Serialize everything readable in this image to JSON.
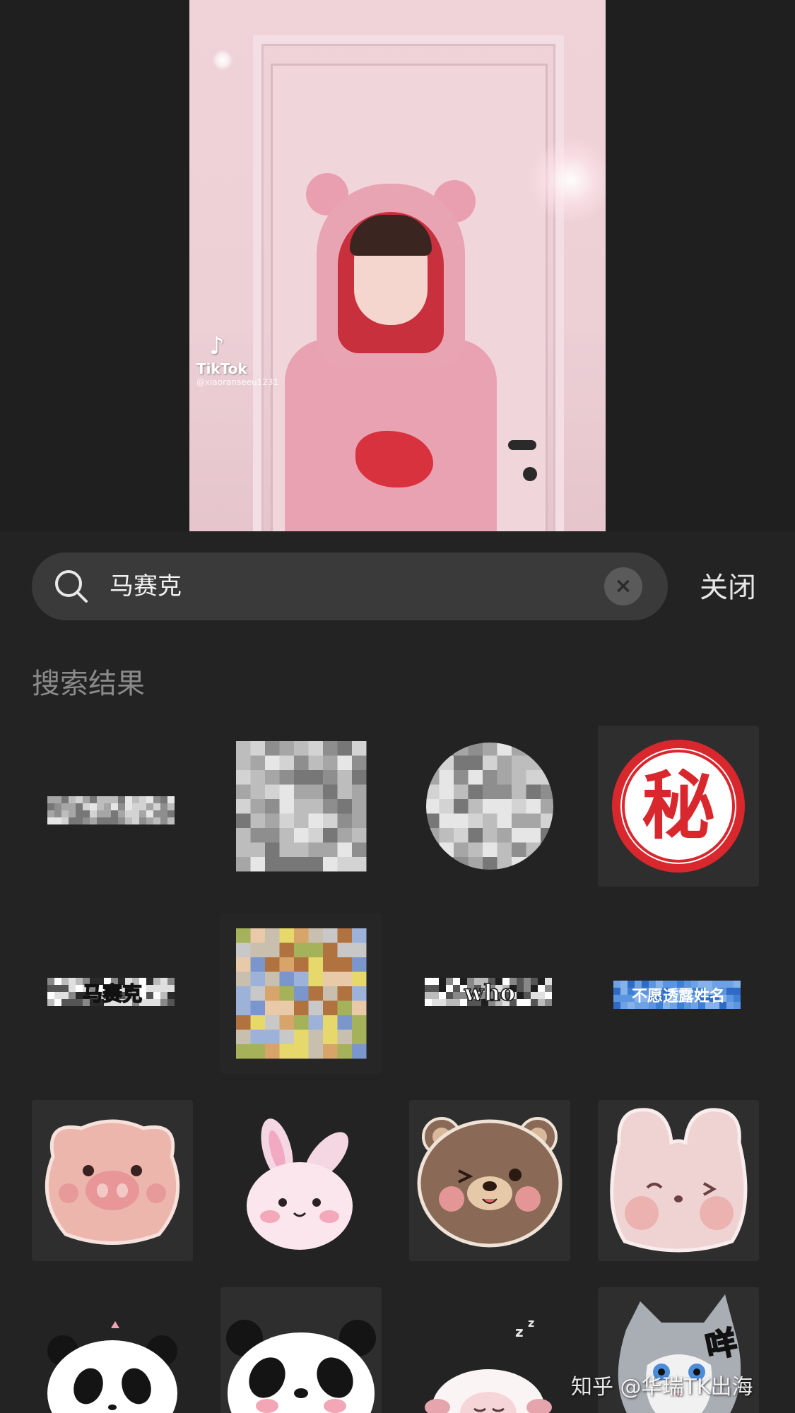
{
  "video": {
    "brand": "TikTok",
    "handle": "@xiaoranseeu1231"
  },
  "search": {
    "query": "马赛克",
    "clear_icon": "close-icon"
  },
  "close_label": "关闭",
  "results_title": "搜索结果",
  "stickers": [
    {
      "name": "mosaic-strip-sticker"
    },
    {
      "name": "mosaic-square-sticker"
    },
    {
      "name": "mosaic-circle-sticker"
    },
    {
      "name": "secret-stamp-sticker",
      "label": "秘"
    },
    {
      "name": "mosaic-label-sticker",
      "label": "马赛克"
    },
    {
      "name": "color-mosaic-sticker"
    },
    {
      "name": "who-mosaic-sticker",
      "label": "who"
    },
    {
      "name": "anonymous-label-sticker",
      "label": "不愿透露姓名"
    },
    {
      "name": "pig-face-sticker"
    },
    {
      "name": "bunny-sticker"
    },
    {
      "name": "bear-face-sticker"
    },
    {
      "name": "pink-bunny-face-sticker"
    },
    {
      "name": "panda-sticker"
    },
    {
      "name": "panda-face-sticker"
    },
    {
      "name": "sleeping-sheep-sticker"
    },
    {
      "name": "cat-sticker",
      "label": "咩"
    }
  ],
  "watermark": "知乎 @华瑞TK出海",
  "colors": {
    "panel_bg": "#232323",
    "search_bg": "#3a3a3a",
    "secret_red": "#d9272e"
  }
}
